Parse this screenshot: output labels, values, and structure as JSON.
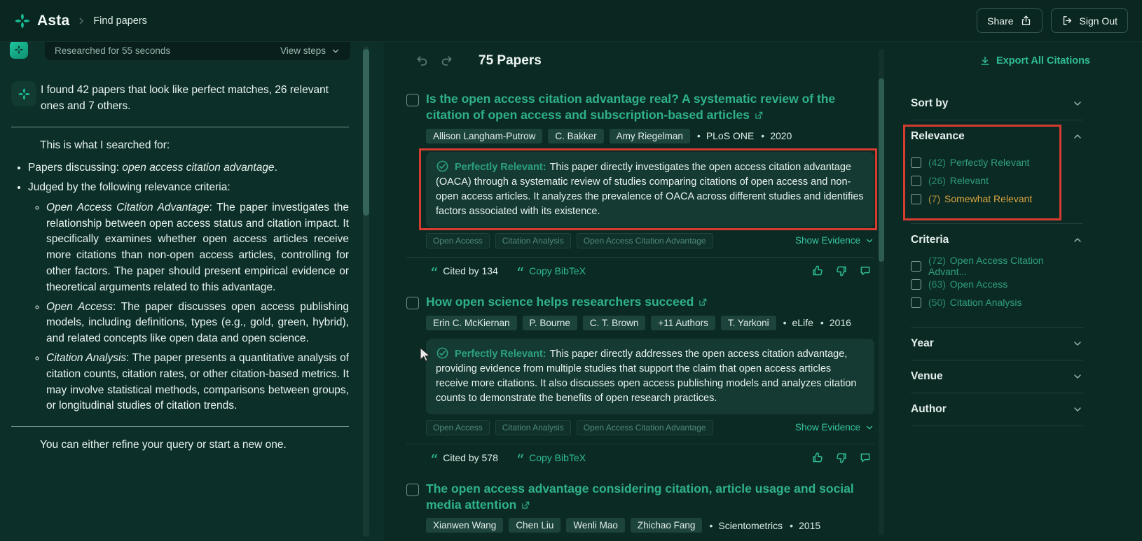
{
  "colors": {
    "accent_green": "#2fbd97",
    "title_green": "#2fb289",
    "label_green": "#2f9f80",
    "warning_yellow": "#d8a53f",
    "annotation_red": "#d63c2f",
    "page_bg": "#0b2a24",
    "chat_panel_bg": "#0d2f29",
    "relevance_box_bg": "#153a33",
    "author_chip_bg": "#1d443c"
  },
  "header": {
    "app_name": "Asta",
    "breadcrumb": "Find papers",
    "share_label": "Share",
    "sign_out_label": "Sign Out"
  },
  "chat": {
    "researched_label": "Researched for 55 seconds",
    "view_steps_label": "View steps",
    "message": "I found 42 papers that look like perfect matches, 26 relevant ones and 7 others.",
    "searched_for_label": "This is what I searched for:",
    "bullet_discussing_prefix": "Papers discussing: ",
    "bullet_discussing_term": "open access citation advantage",
    "bullet_discussing_suffix": ".",
    "bullet_judged": "Judged by the following relevance criteria:",
    "criteria": [
      {
        "term": "Open Access Citation Advantage",
        "text": ": The paper investigates the relationship between open access status and citation impact. It specifically examines whether open access articles receive more citations than non-open access articles, controlling for other factors. The paper should present empirical evidence or theoretical arguments related to this advantage."
      },
      {
        "term": "Open Access",
        "text": ": The paper discusses open access publishing models, including definitions, types (e.g., gold, green, hybrid), and related concepts like open data and open science."
      },
      {
        "term": "Citation Analysis",
        "text": ": The paper presents a quantitative analysis of citation counts, citation rates, or other citation-based metrics. It may involve statistical methods, comparisons between groups, or longitudinal studies of citation trends."
      }
    ],
    "footer_note": "You can either refine your query or start a new one."
  },
  "results": {
    "count_label": "75 Papers",
    "export_label": "Export All Citations",
    "show_evidence_label": "Show Evidence",
    "copy_bibtex_label": "Copy BibTeX",
    "relevance_badge": "Perfectly Relevant:",
    "papers": [
      {
        "title": "Is the open access citation advantage real? A systematic review of the citation of open access and subscription-based articles",
        "authors": [
          "Allison Langham-Putrow",
          "C. Bakker",
          "Amy Riegelman"
        ],
        "venue": "PLoS ONE",
        "year": "2020",
        "relevance_text": "This paper directly investigates the open access citation advantage (OACA) through a systematic review of studies comparing citations of open access and non-open access articles. It analyzes the prevalence of OACA across different studies and identifies factors associated with its existence.",
        "tags": [
          "Open Access",
          "Citation Analysis",
          "Open Access Citation Advantage"
        ],
        "cited_by": "Cited by 134"
      },
      {
        "title": "How open science helps researchers succeed",
        "authors": [
          "Erin C. McKiernan",
          "P. Bourne",
          "C. T. Brown",
          "+11 Authors",
          "T. Yarkoni"
        ],
        "venue": "eLife",
        "year": "2016",
        "relevance_text": "This paper directly addresses the open access citation advantage, providing evidence from multiple studies that support the claim that open access articles receive more citations. It also discusses open access publishing models and analyzes citation counts to demonstrate the benefits of open research practices.",
        "tags": [
          "Open Access",
          "Citation Analysis",
          "Open Access Citation Advantage"
        ],
        "cited_by": "Cited by 578"
      },
      {
        "title": "The open access advantage considering citation, article usage and social media attention",
        "authors": [
          "Xianwen Wang",
          "Chen Liu",
          "Wenli Mao",
          "Zhichao Fang"
        ],
        "venue": "Scientometrics",
        "year": "2015"
      }
    ]
  },
  "filters": {
    "sort_by_label": "Sort by",
    "relevance_title": "Relevance",
    "relevance_options": [
      {
        "count": "(42)",
        "label": "Perfectly Relevant"
      },
      {
        "count": "(26)",
        "label": "Relevant"
      },
      {
        "count": "(7)",
        "label": "Somewhat Relevant"
      }
    ],
    "criteria_title": "Criteria",
    "criteria_options": [
      {
        "count": "(72)",
        "label": "Open Access Citation Advant..."
      },
      {
        "count": "(63)",
        "label": "Open Access"
      },
      {
        "count": "(50)",
        "label": "Citation Analysis"
      }
    ],
    "year_title": "Year",
    "venue_title": "Venue",
    "author_title": "Author"
  },
  "icons": {
    "quote": "“",
    "breadcrumb_separator": "›"
  }
}
